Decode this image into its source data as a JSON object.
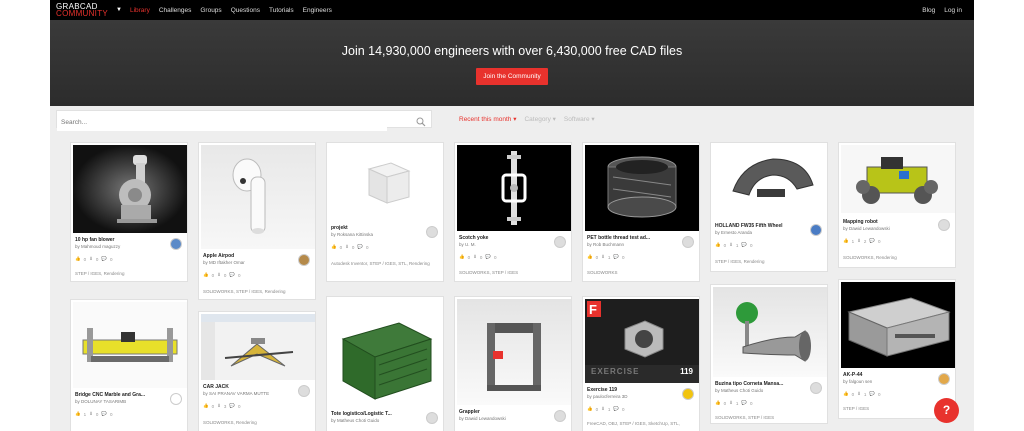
{
  "nav": {
    "logo_top": "GRABCAD",
    "logo_bottom": "COMMUNITY",
    "links": [
      "Library",
      "Challenges",
      "Groups",
      "Questions",
      "Tutorials",
      "Engineers"
    ],
    "right_links": [
      "Blog",
      "Log in"
    ]
  },
  "hero": {
    "headline": "Join 14,930,000 engineers with over 6,430,000 free CAD files",
    "cta": "Join the Community"
  },
  "filters": {
    "search_placeholder": "Search...",
    "recent": "Recent this month",
    "category": "Category",
    "software": "Software"
  },
  "cards": [
    {
      "title": "10 hp fan blower",
      "author": "by Mahmoud maguzzy",
      "likes": "0",
      "downloads": "0",
      "comments": "0",
      "tags": "STEP / IGES, Rendering"
    },
    {
      "title": "Apple Airpod",
      "author": "by MD Iftakher Omar",
      "likes": "0",
      "downloads": "0",
      "comments": "0",
      "tags": "SOLIDWORKS, STEP / IGES, Rendering"
    },
    {
      "title": "projekt",
      "author": "by Roksana Kittinska",
      "likes": "0",
      "downloads": "0",
      "comments": "0",
      "tags": "Autodesk Inventor, STEP / IGES, STL, Rendering"
    },
    {
      "title": "Scotch yoke",
      "author": "by U. M.",
      "likes": "0",
      "downloads": "0",
      "comments": "0",
      "tags": "SOLIDWORKS, STEP / IGES"
    },
    {
      "title": "PET bottle thread test ad...",
      "author": "by Rob Buchmann",
      "likes": "0",
      "downloads": "1",
      "comments": "0",
      "tags": "SOLIDWORKS"
    },
    {
      "title": "HOLLAND FW35 Fifth Wheel",
      "author": "by Ernesto Aranda",
      "likes": "0",
      "downloads": "1",
      "comments": "0",
      "tags": "STEP / IGES, Rendering"
    },
    {
      "title": "Mapping robot",
      "author": "by Dawid Lewandowski",
      "likes": "1",
      "downloads": "2",
      "comments": "0",
      "tags": "SOLIDWORKS, Rendering"
    },
    {
      "title": "Bridge CNC Marble and Gra...",
      "author": "by DOLUNAY TASARIMB",
      "likes": "1",
      "downloads": "0",
      "comments": "0",
      "tags": ""
    },
    {
      "title": "CAR JACK",
      "author": "by SAI PRANAV VARMA MUTTE",
      "likes": "0",
      "downloads": "3",
      "comments": "0",
      "tags": "SOLIDWORKS, Rendering"
    },
    {
      "title": "Tote logistico/Logistic T...",
      "author": "by Matheus Choti Guido",
      "likes": "",
      "downloads": "",
      "comments": "",
      "tags": ""
    },
    {
      "title": "Grappler",
      "author": "by Dawid Lewandowski",
      "likes": "",
      "downloads": "",
      "comments": "",
      "tags": ""
    },
    {
      "title": "Exercise 119",
      "author": "by paulocferreira 3D",
      "likes": "0",
      "downloads": "1",
      "comments": "0",
      "tags": "FreeCAD, OBJ, STEP / IGES, SketchUp, STL,"
    },
    {
      "title": "Buzina tipo Corneta Mansa...",
      "author": "by Matheus Choti Guido",
      "likes": "0",
      "downloads": "1",
      "comments": "0",
      "tags": "SOLIDWORKS, STEP / IGES"
    },
    {
      "title": "AK-P-44",
      "author": "by falgoun sen",
      "likes": "0",
      "downloads": "1",
      "comments": "0",
      "tags": "STEP / IGES"
    }
  ],
  "exercise_badge": "EXERCISE",
  "exercise_number": "119",
  "help": "?"
}
